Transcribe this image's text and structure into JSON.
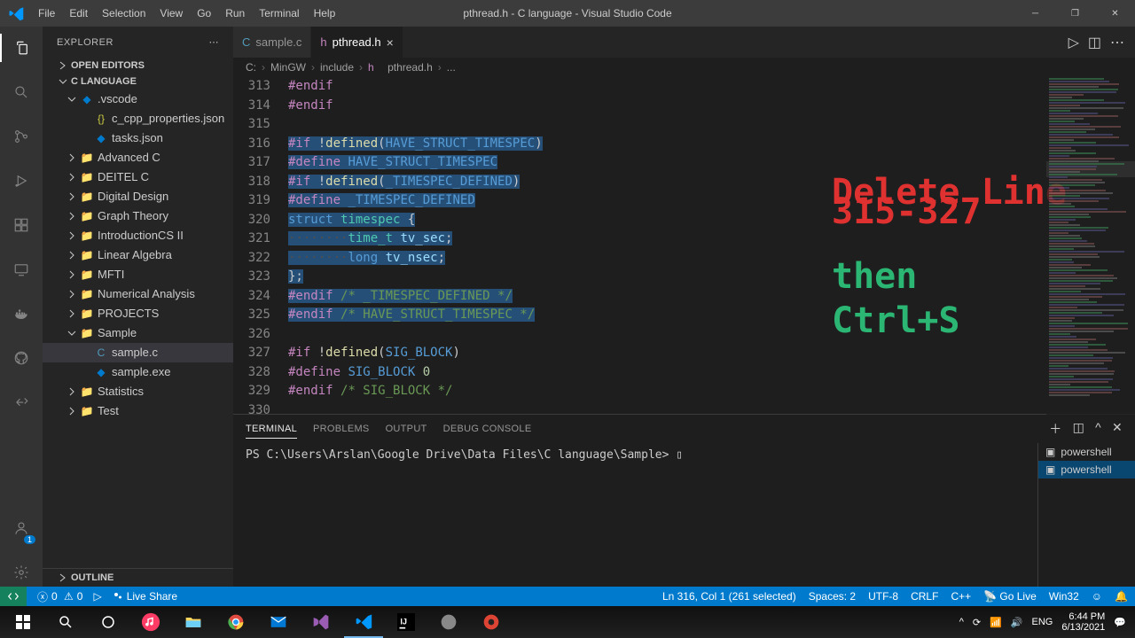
{
  "title": "pthread.h - C language - Visual Studio Code",
  "menus": [
    "File",
    "Edit",
    "Selection",
    "View",
    "Go",
    "Run",
    "Terminal",
    "Help"
  ],
  "explorer": {
    "label": "EXPLORER",
    "open_editors": "OPEN EDITORS",
    "project": "C LANGUAGE",
    "outline": "OUTLINE",
    "tree": [
      {
        "depth": 1,
        "chev": "v",
        "icon": "vs",
        "label": ".vscode"
      },
      {
        "depth": 2,
        "chev": "",
        "icon": "json",
        "label": "c_cpp_properties.json"
      },
      {
        "depth": 2,
        "chev": "",
        "icon": "vs",
        "label": "tasks.json"
      },
      {
        "depth": 1,
        "chev": ">",
        "icon": "folder",
        "label": "Advanced C"
      },
      {
        "depth": 1,
        "chev": ">",
        "icon": "folder",
        "label": "DEITEL C"
      },
      {
        "depth": 1,
        "chev": ">",
        "icon": "folder",
        "label": "Digital Design"
      },
      {
        "depth": 1,
        "chev": ">",
        "icon": "folder",
        "label": "Graph Theory"
      },
      {
        "depth": 1,
        "chev": ">",
        "icon": "folder",
        "label": "IntroductionCS II"
      },
      {
        "depth": 1,
        "chev": ">",
        "icon": "folder",
        "label": "Linear Algebra"
      },
      {
        "depth": 1,
        "chev": ">",
        "icon": "folder",
        "label": "MFTI"
      },
      {
        "depth": 1,
        "chev": ">",
        "icon": "folder",
        "label": "Numerical Analysis"
      },
      {
        "depth": 1,
        "chev": ">",
        "icon": "folder",
        "label": "PROJECTS"
      },
      {
        "depth": 1,
        "chev": "v",
        "icon": "folder",
        "label": "Sample"
      },
      {
        "depth": 2,
        "chev": "",
        "icon": "c",
        "label": "sample.c",
        "selected": true
      },
      {
        "depth": 2,
        "chev": "",
        "icon": "vs",
        "label": "sample.exe"
      },
      {
        "depth": 1,
        "chev": ">",
        "icon": "folder",
        "label": "Statistics"
      },
      {
        "depth": 1,
        "chev": ">",
        "icon": "folder",
        "label": "Test"
      }
    ]
  },
  "tabs": [
    {
      "icon": "c",
      "label": "sample.c",
      "active": false
    },
    {
      "icon": "h",
      "label": "pthread.h",
      "active": true,
      "close": true
    }
  ],
  "breadcrumb": [
    "C:",
    "MinGW",
    "include",
    "pthread.h",
    "..."
  ],
  "gutter_start": 313,
  "lines": [
    {
      "sel": false,
      "html": "<span class='kw-pp'>#endif</span>"
    },
    {
      "sel": false,
      "html": "<span class='kw-pp'>#endif</span>"
    },
    {
      "sel": false,
      "html": ""
    },
    {
      "sel": true,
      "html": "<span class='kw-pp'>#if</span> !<span class='kw-func'>defined</span>(<span class='kw-macro'>HAVE_STRUCT_TIMESPEC</span>)"
    },
    {
      "sel": true,
      "html": "<span class='kw-pp'>#define</span> <span class='kw-macro'>HAVE_STRUCT_TIMESPEC</span>"
    },
    {
      "sel": true,
      "html": "<span class='kw-pp'>#if</span> !<span class='kw-func'>defined</span>(<span class='kw-macro'>_TIMESPEC_DEFINED</span>)"
    },
    {
      "sel": true,
      "html": "<span class='kw-pp'>#define</span> <span class='kw-macro'>_TIMESPEC_DEFINED</span>"
    },
    {
      "sel": true,
      "html": "<span class='kw-type'>struct</span> <span class='kw-struct'>timespec</span> {"
    },
    {
      "sel": true,
      "html": "<span style='color:#505050'>········</span><span class='kw-struct'>time_t</span> <span class='kw-id'>tv_sec</span>;"
    },
    {
      "sel": true,
      "html": "<span style='color:#505050'>········</span><span class='kw-type'>long</span> <span class='kw-id'>tv_nsec</span>;"
    },
    {
      "sel": true,
      "html": "};"
    },
    {
      "sel": true,
      "html": "<span class='kw-pp'>#endif</span> <span class='kw-comment'>/* _TIMESPEC_DEFINED */</span>"
    },
    {
      "sel": true,
      "html": "<span class='kw-pp'>#endif</span> <span class='kw-comment'>/* HAVE_STRUCT_TIMESPEC */</span>"
    },
    {
      "sel": false,
      "html": ""
    },
    {
      "sel": false,
      "html": "<span class='kw-pp'>#if</span> !<span class='kw-func'>defined</span>(<span class='kw-macro'>SIG_BLOCK</span>)"
    },
    {
      "sel": false,
      "html": "<span class='kw-pp'>#define</span> <span class='kw-macro'>SIG_BLOCK</span> <span class='kw-num'>0</span>"
    },
    {
      "sel": false,
      "html": "<span class='kw-pp'>#endif</span> <span class='kw-comment'>/* SIG_BLOCK */</span>"
    },
    {
      "sel": false,
      "html": ""
    }
  ],
  "overlay": {
    "red": "Delete Line 315-327",
    "g1": "then",
    "g2": "Ctrl+S"
  },
  "panel": {
    "tabs": [
      "TERMINAL",
      "PROBLEMS",
      "OUTPUT",
      "DEBUG CONSOLE"
    ],
    "prompt": "PS C:\\Users\\Arslan\\Google Drive\\Data Files\\C language\\Sample> ▯",
    "shells": [
      "powershell",
      "powershell"
    ]
  },
  "status": {
    "errors": "0",
    "warnings": "0",
    "liveshare": "Live Share",
    "cursor": "Ln 316, Col 1 (261 selected)",
    "spaces": "Spaces: 2",
    "enc": "UTF-8",
    "eol": "CRLF",
    "lang": "C++",
    "golive": "Go Live",
    "win": "Win32",
    "bell": "🔔"
  },
  "tray": {
    "lang": "ENG",
    "time": "6:44 PM",
    "date": "6/13/2021"
  }
}
